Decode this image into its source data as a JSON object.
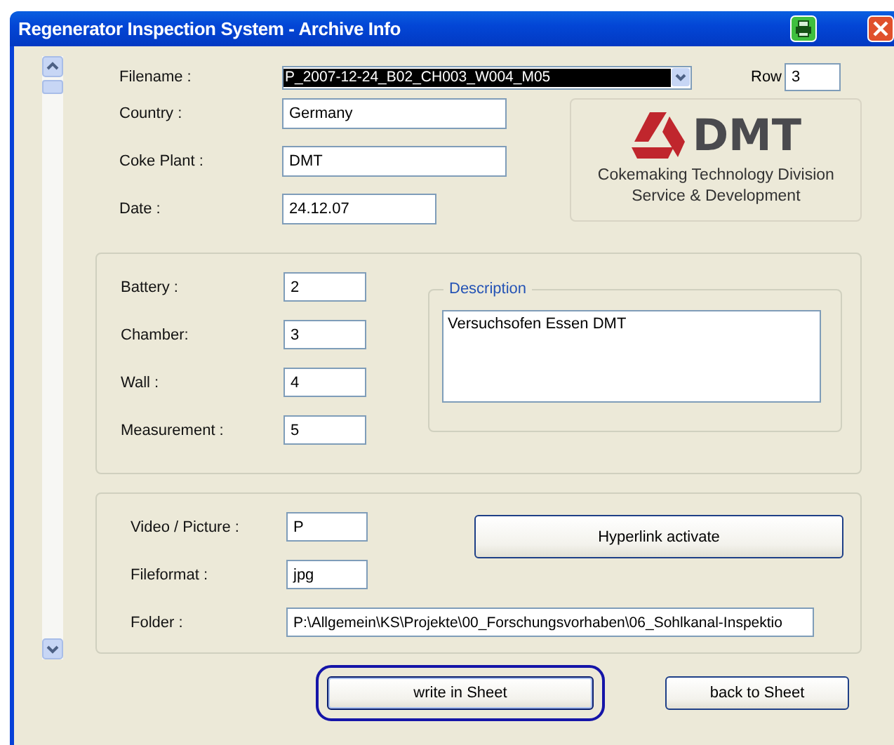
{
  "window": {
    "title": "Regenerator Inspection System - Archive Info"
  },
  "header": {
    "filename": {
      "label": "Filename :",
      "value": "P_2007-12-24_B02_CH003_W004_M05",
      "selected": true
    },
    "row": {
      "label": "Row",
      "value": "3"
    },
    "fields": [
      {
        "label": "Country :",
        "value": "Germany"
      },
      {
        "label": "Coke Plant :",
        "value": "DMT"
      },
      {
        "label": "Date :",
        "value": "24.12.07"
      }
    ]
  },
  "logo": {
    "name": "DMT",
    "lines": [
      "Cokemaking Technology Division",
      "Service & Development"
    ]
  },
  "location": {
    "fields": [
      {
        "label": "Battery :",
        "value": "2"
      },
      {
        "label": "Chamber:",
        "value": "3"
      },
      {
        "label": "Wall :",
        "value": "4"
      },
      {
        "label": "Measurement :",
        "value": "5"
      }
    ],
    "description": {
      "legend": "Description",
      "value": "Versuchsofen Essen DMT"
    }
  },
  "media": {
    "fields": [
      {
        "label": "Video / Picture :",
        "value": "P"
      },
      {
        "label": "Fileformat :",
        "value": "jpg"
      },
      {
        "label": "Folder :",
        "value": "P:\\Allgemein\\KS\\Projekte\\00_Forschungsvorhaben\\06_Sohlkanal-Inspektio"
      }
    ],
    "button": "Hyperlink activate"
  },
  "buttons": [
    {
      "label": "write in Sheet",
      "focused": true
    },
    {
      "label": "back to Sheet",
      "focused": false
    }
  ]
}
